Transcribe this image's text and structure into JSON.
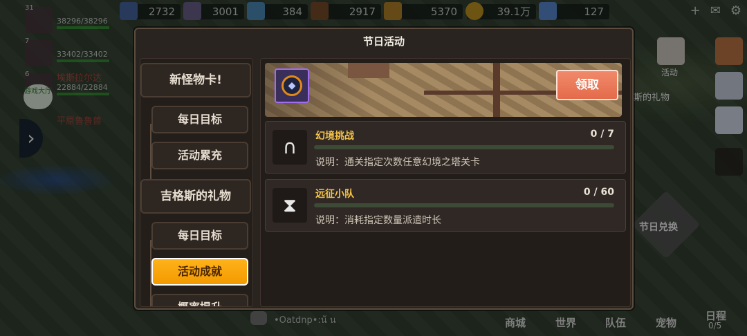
{
  "resources": [
    {
      "value": "2732",
      "icon": "gem-icon",
      "color": "#6a8fd0"
    },
    {
      "value": "3001",
      "icon": "ore-icon",
      "color": "#8a7fb0"
    },
    {
      "value": "384",
      "icon": "crystal-icon",
      "color": "#6db0e0"
    },
    {
      "value": "2917",
      "icon": "wood-icon",
      "color": "#a06a3a"
    },
    {
      "value": "5370",
      "icon": "wheat-icon",
      "color": "#d9a535"
    },
    {
      "value": "39.1万",
      "icon": "coin-icon",
      "color": "#e3b230"
    },
    {
      "value": "127",
      "icon": "diamond-icon",
      "color": "#7fb5ff"
    }
  ],
  "team": [
    {
      "level": "31",
      "name": "",
      "hp": "38296/38296"
    },
    {
      "level": "7",
      "name": "",
      "hp": "33402/33402"
    },
    {
      "level": "6",
      "name": "埃斯拉尔达",
      "hp": "22884/22884"
    }
  ],
  "team_extra": "平原鲁鲁兽",
  "game_badge": "游戏大厅",
  "dialog": {
    "title": "节日活动",
    "menu": [
      {
        "type": "category",
        "label": "新怪物卡!"
      },
      {
        "type": "sub",
        "label": "每日目标"
      },
      {
        "type": "sub",
        "label": "活动累充"
      },
      {
        "type": "category",
        "label": "吉格斯的礼物"
      },
      {
        "type": "sub",
        "label": "每日目标"
      },
      {
        "type": "sub",
        "label": "活动成就",
        "active": true
      },
      {
        "type": "sub",
        "label": "概率提升"
      }
    ],
    "claim_label": "领取",
    "tasks": [
      {
        "name": "幻境挑战",
        "progress": "0 / 7",
        "progress_fraction": 0,
        "desc": "说明：通关指定次数任意幻境之塔关卡",
        "icon": "horseshoe-icon"
      },
      {
        "name": "远征小队",
        "progress": "0 / 60",
        "progress_fraction": 0,
        "desc": "说明：消耗指定数量派遣时长",
        "icon": "hourglass-icon"
      }
    ]
  },
  "hud_right": {
    "activity_label": "活动",
    "gift_label": "斯的礼物",
    "festival_exchange": "节日兑换",
    "schedule_label": "日程",
    "schedule_count": "0/5"
  },
  "bottom_nav": [
    "商城",
    "世界",
    "队伍",
    "宠物"
  ],
  "chat_text": "•Oatdnp•:น้ น"
}
